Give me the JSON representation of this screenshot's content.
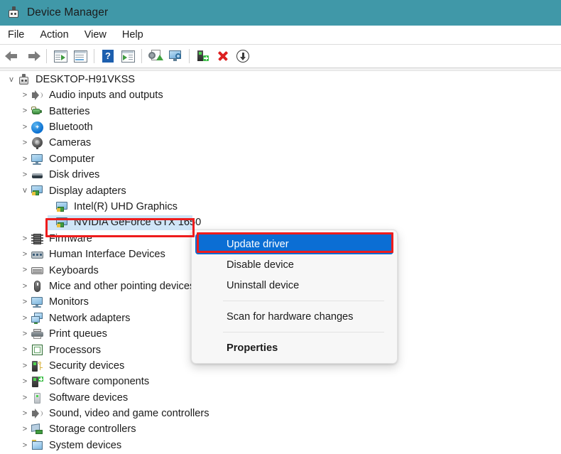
{
  "window": {
    "title": "Device Manager",
    "titlebar_color": "#4098a8",
    "icon": "device-manager-icon"
  },
  "menubar": {
    "items": [
      {
        "label": "File"
      },
      {
        "label": "Action"
      },
      {
        "label": "View"
      },
      {
        "label": "Help"
      }
    ]
  },
  "toolbar": {
    "buttons": [
      {
        "icon": "back-arrow-icon"
      },
      {
        "icon": "forward-arrow-icon"
      },
      {
        "separator": true
      },
      {
        "icon": "show-hidden-window-icon"
      },
      {
        "icon": "properties-window-icon"
      },
      {
        "separator": true
      },
      {
        "icon": "help-question-icon"
      },
      {
        "icon": "view-window-icon"
      },
      {
        "separator": true
      },
      {
        "icon": "update-driver-icon"
      },
      {
        "icon": "scan-hardware-monitor-icon"
      },
      {
        "separator": true
      },
      {
        "icon": "add-legacy-device-icon"
      },
      {
        "icon": "uninstall-device-red-x-icon"
      },
      {
        "icon": "disable-device-down-arrow-icon"
      }
    ]
  },
  "tree": {
    "root": {
      "label": "DESKTOP-H91VKSS",
      "icon": "device-manager-icon",
      "expanded": true,
      "chevron": "v"
    },
    "items": [
      {
        "label": "Audio inputs and outputs",
        "icon": "speaker-icon",
        "chevron": ">",
        "indent": 1
      },
      {
        "label": "Batteries",
        "icon": "battery-icon",
        "chevron": ">",
        "indent": 1
      },
      {
        "label": "Bluetooth",
        "icon": "bluetooth-icon",
        "chevron": ">",
        "indent": 1
      },
      {
        "label": "Cameras",
        "icon": "camera-icon",
        "chevron": ">",
        "indent": 1
      },
      {
        "label": "Computer",
        "icon": "monitor-icon",
        "chevron": ">",
        "indent": 1
      },
      {
        "label": "Disk drives",
        "icon": "disk-drive-icon",
        "chevron": ">",
        "indent": 1
      },
      {
        "label": "Display adapters",
        "icon": "display-adapter-icon",
        "chevron": "v",
        "indent": 1
      },
      {
        "label": "Intel(R) UHD Graphics",
        "icon": "display-adapter-icon",
        "chevron": "",
        "indent": 2
      },
      {
        "label": "NVIDIA GeForce GTX 1650",
        "icon": "display-adapter-icon",
        "chevron": "",
        "indent": 2,
        "selected": true
      },
      {
        "label": "Firmware",
        "icon": "firmware-chip-icon",
        "chevron": ">",
        "indent": 1
      },
      {
        "label": "Human Interface Devices",
        "icon": "hid-icon",
        "chevron": ">",
        "indent": 1
      },
      {
        "label": "Keyboards",
        "icon": "keyboard-icon",
        "chevron": ">",
        "indent": 1
      },
      {
        "label": "Mice and other pointing devices",
        "icon": "mouse-icon",
        "chevron": ">",
        "indent": 1
      },
      {
        "label": "Monitors",
        "icon": "monitor-icon",
        "chevron": ">",
        "indent": 1
      },
      {
        "label": "Network adapters",
        "icon": "network-adapter-icon",
        "chevron": ">",
        "indent": 1
      },
      {
        "label": "Print queues",
        "icon": "printer-icon",
        "chevron": ">",
        "indent": 1
      },
      {
        "label": "Processors",
        "icon": "processor-icon",
        "chevron": ">",
        "indent": 1
      },
      {
        "label": "Security devices",
        "icon": "security-device-icon",
        "chevron": ">",
        "indent": 1
      },
      {
        "label": "Software components",
        "icon": "software-component-icon",
        "chevron": ">",
        "indent": 1
      },
      {
        "label": "Software devices",
        "icon": "software-device-icon",
        "chevron": ">",
        "indent": 1
      },
      {
        "label": "Sound, video and game controllers",
        "icon": "speaker-icon",
        "chevron": ">",
        "indent": 1
      },
      {
        "label": "Storage controllers",
        "icon": "storage-controller-icon",
        "chevron": ">",
        "indent": 1
      },
      {
        "label": "System devices",
        "icon": "system-device-icon",
        "chevron": ">",
        "indent": 1
      }
    ]
  },
  "context_menu": {
    "items": [
      {
        "label": "Update driver",
        "highlighted": true
      },
      {
        "label": "Disable device"
      },
      {
        "label": "Uninstall device"
      },
      {
        "separator": true
      },
      {
        "label": "Scan for hardware changes"
      },
      {
        "separator": true
      },
      {
        "label": "Properties",
        "bold": true
      }
    ],
    "highlight_color": "#0b6ed4"
  },
  "annotations": {
    "color": "#ee1c1c",
    "boxes": [
      {
        "target": "NVIDIA GeForce GTX 1650"
      },
      {
        "target": "Update driver"
      }
    ]
  }
}
